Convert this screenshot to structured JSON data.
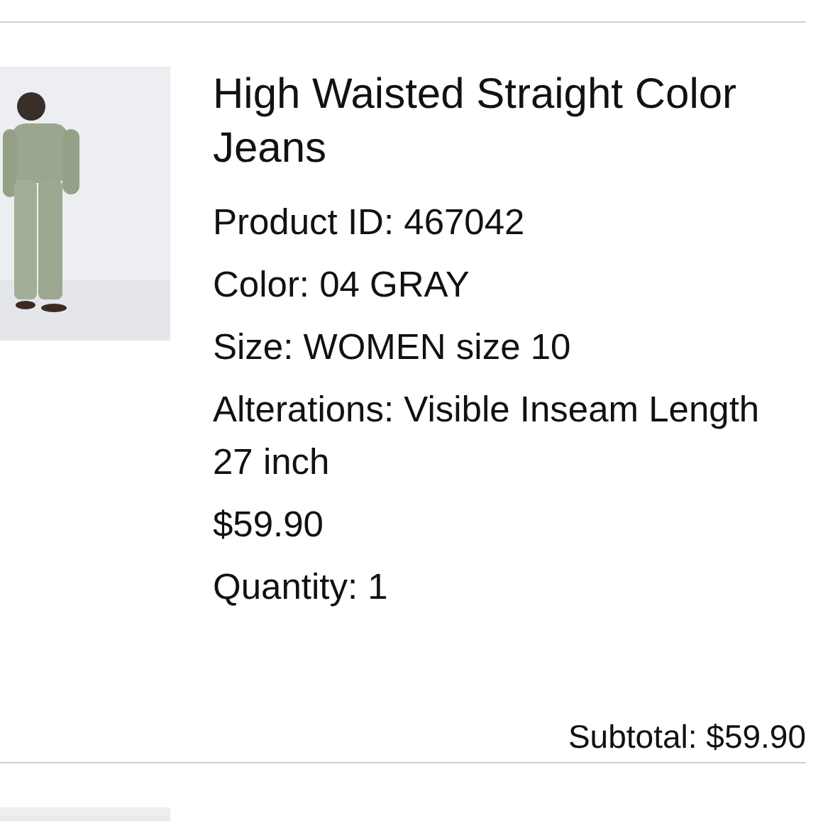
{
  "item": {
    "title": "High Waisted Straight Color Jeans",
    "details": [
      "Product ID: 467042",
      "Color: 04 GRAY",
      "Size: WOMEN size 10",
      "Alterations: Visible Inseam Length 27 inch",
      "$59.90",
      "Quantity: 1"
    ],
    "subtotal": "Subtotal: $59.90"
  }
}
